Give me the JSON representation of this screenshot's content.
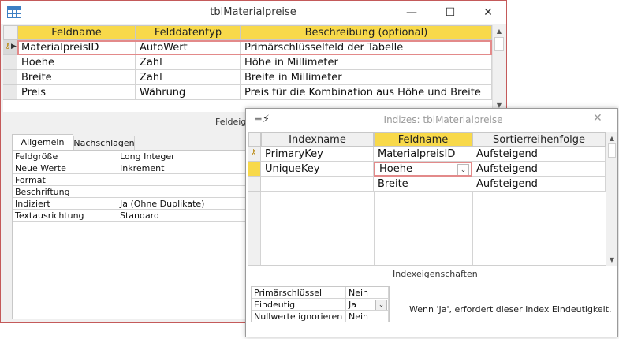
{
  "main_window": {
    "title": "tblMaterialpreise",
    "columns": [
      "Feldname",
      "Felddatentyp",
      "Beschreibung (optional)"
    ],
    "rows": [
      {
        "name": "MaterialpreisID",
        "type": "AutoWert",
        "desc": "Primärschlüsselfeld der Tabelle"
      },
      {
        "name": "Hoehe",
        "type": "Zahl",
        "desc": "Höhe in Millimeter"
      },
      {
        "name": "Breite",
        "type": "Zahl",
        "desc": "Breite in Millimeter"
      },
      {
        "name": "Preis",
        "type": "Währung",
        "desc": "Preis für die Kombination aus Höhe und Breite"
      }
    ],
    "field_props_label": "Feldeig",
    "tabs": [
      "Allgemein",
      "Nachschlagen"
    ],
    "properties": [
      {
        "label": "Feldgröße",
        "value": "Long Integer"
      },
      {
        "label": "Neue Werte",
        "value": "Inkrement"
      },
      {
        "label": "Format",
        "value": ""
      },
      {
        "label": "Beschriftung",
        "value": ""
      },
      {
        "label": "Indiziert",
        "value": "Ja (Ohne Duplikate)"
      },
      {
        "label": "Textausrichtung",
        "value": "Standard"
      }
    ]
  },
  "index_window": {
    "title": "Indizes: tblMaterialpreise",
    "columns": [
      "Indexname",
      "Feldname",
      "Sortierreihenfolge"
    ],
    "rows": [
      {
        "index": "PrimaryKey",
        "field": "MaterialpreisID",
        "order": "Aufsteigend"
      },
      {
        "index": "UniqueKey",
        "field": "Hoehe",
        "order": "Aufsteigend"
      },
      {
        "index": "",
        "field": "Breite",
        "order": "Aufsteigend"
      }
    ],
    "props_heading": "Indexeigenschaften",
    "properties": [
      {
        "label": "Primärschlüssel",
        "value": "Nein"
      },
      {
        "label": "Eindeutig",
        "value": "Ja"
      },
      {
        "label": "Nullwerte ignorieren",
        "value": "Nein"
      }
    ],
    "help_text": "Wenn 'Ja', erfordert dieser Index Eindeutigkeit."
  },
  "icons": [
    "table-icon",
    "minimize-icon",
    "maximize-icon",
    "close-icon",
    "key-icon",
    "row-selector-icon",
    "indexes-icon",
    "dropdown-arrow-icon",
    "scroll-up-icon",
    "scroll-down-icon"
  ]
}
